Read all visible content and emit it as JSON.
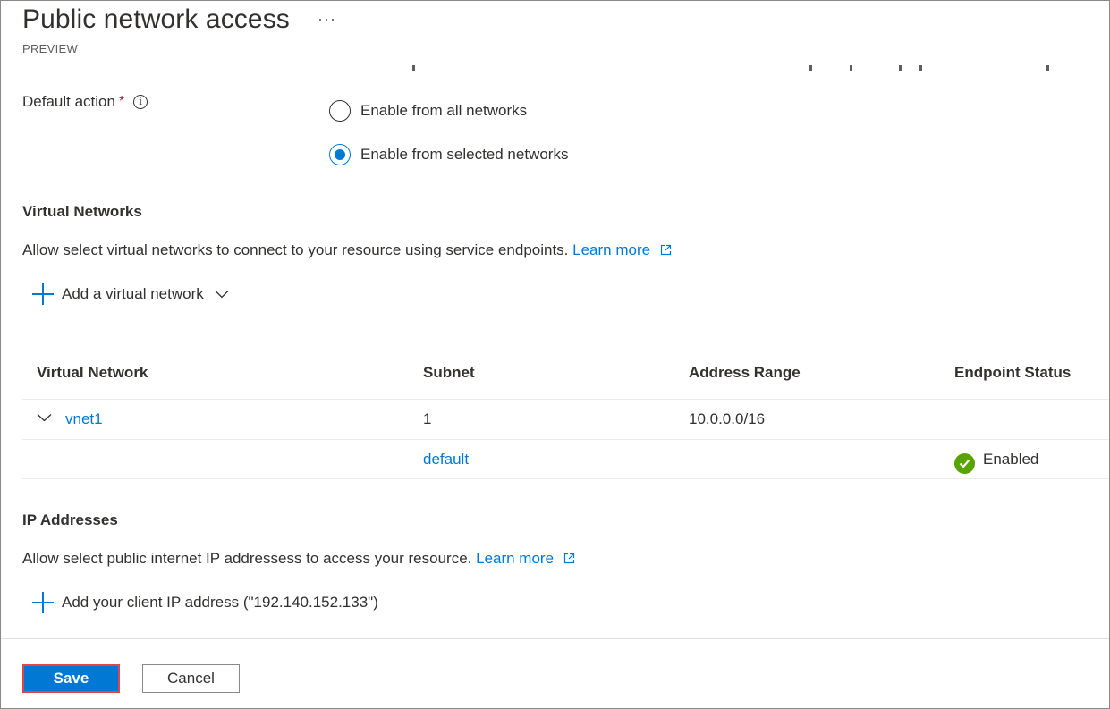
{
  "header": {
    "title": "Public network access",
    "more_label": "···",
    "subtitle": "PREVIEW"
  },
  "default_action": {
    "label": "Default action",
    "required_mark": "*",
    "info_glyph": "i",
    "options": [
      {
        "label": "Enable from all networks",
        "selected": false
      },
      {
        "label": "Enable from selected networks",
        "selected": true
      }
    ]
  },
  "virtual_networks": {
    "title": "Virtual Networks",
    "description": "Allow select virtual networks to connect to your resource using service endpoints.",
    "learn_more": "Learn more",
    "add_label": "Add a virtual network",
    "columns": [
      "Virtual Network",
      "Subnet",
      "Address Range",
      "Endpoint Status"
    ],
    "rows": [
      {
        "vnet": "vnet1",
        "subnet": "1",
        "address_range": "10.0.0.0/16",
        "status": ""
      },
      {
        "vnet": "",
        "subnet": "default",
        "address_range": "",
        "status": "Enabled"
      }
    ]
  },
  "ip_addresses": {
    "title": "IP Addresses",
    "description": "Allow select public internet IP addressess to access your resource.",
    "learn_more": "Learn more",
    "add_label": "Add your client IP address (\"192.140.152.133\")"
  },
  "footer": {
    "save_label": "Save",
    "cancel_label": "Cancel"
  },
  "colors": {
    "accent": "#0078d4",
    "success": "#57a300",
    "text": "#323130",
    "highlight_border": "#e04646"
  }
}
